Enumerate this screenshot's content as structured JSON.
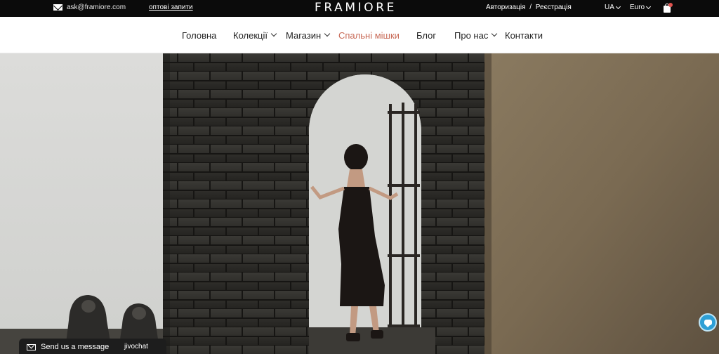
{
  "topbar": {
    "email": "ask@framiore.com",
    "email_icon": "mail-icon",
    "wholesale_link": "оптові запити",
    "logo": "FRAMIORE",
    "login": "Авторизація",
    "separator": "/",
    "register": "Реєстрація",
    "language": "UA",
    "currency": "Euro",
    "cart_icon": "shopping-bag-icon"
  },
  "nav": {
    "items": [
      {
        "label": "Головна",
        "has_dropdown": false
      },
      {
        "label": "Колекції",
        "has_dropdown": true
      },
      {
        "label": "Магазин",
        "has_dropdown": true
      },
      {
        "label": "Спальні мішки",
        "has_dropdown": false,
        "active": true
      },
      {
        "label": "Блог",
        "has_dropdown": false
      },
      {
        "label": "Про нас",
        "has_dropdown": true
      },
      {
        "label": "Контакти",
        "has_dropdown": false
      }
    ]
  },
  "hero": {
    "image": "woman-in-black-slip-dress-standing-in-stone-archway-photo"
  },
  "chat": {
    "label": "Send us a message",
    "brand": "jivochat",
    "icon": "envelope-icon",
    "bubble_icon": "chat-bubble-icon"
  },
  "colors": {
    "topbar_bg": "#0b0b0b",
    "accent": "#c86a57",
    "chat_bg": "#1d1d1d",
    "chat_bubble": "#2e9fd5"
  }
}
